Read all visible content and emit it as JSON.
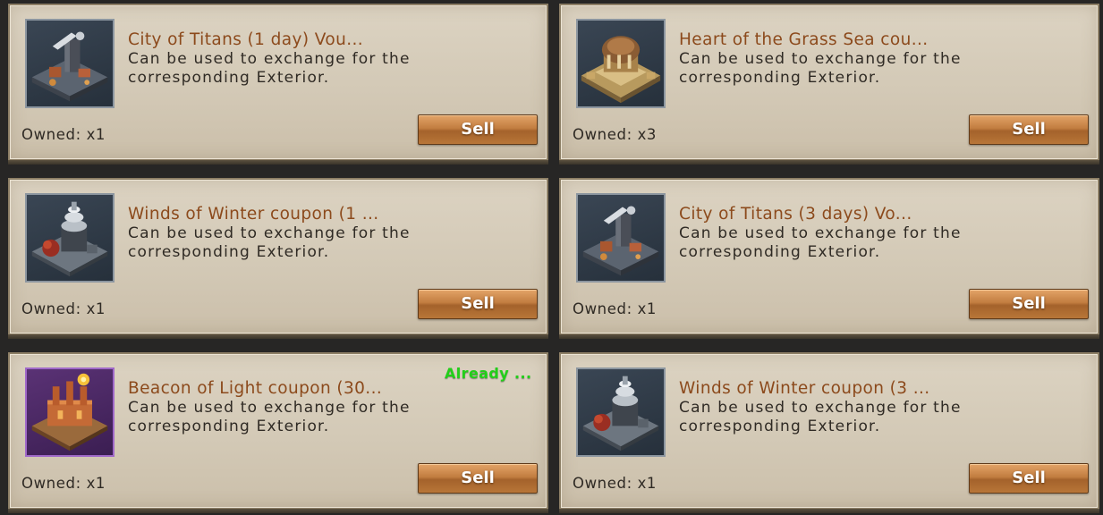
{
  "coupons": [
    {
      "title": "City of Titans (1 day) Vou...",
      "description": "Can be used to exchange for the corresponding Exterior.",
      "owned": "Owned: x1",
      "sell_label": "Sell",
      "icon": "city-of-titans-exterior-icon",
      "frame_color": "#8c96a0"
    },
    {
      "title": "Heart of the Grass Sea cou...",
      "description": "Can be used to exchange for the corresponding Exterior.",
      "owned": "Owned: x3",
      "sell_label": "Sell",
      "icon": "heart-of-the-grass-sea-exterior-icon",
      "frame_color": "#8c96a0"
    },
    {
      "title": "Winds of Winter coupon (1 ...",
      "description": "Can be used to exchange for the corresponding Exterior.",
      "owned": "Owned: x1",
      "sell_label": "Sell",
      "icon": "winds-of-winter-exterior-icon",
      "frame_color": "#8c96a0"
    },
    {
      "title": "City of Titans (3 days) Vo...",
      "description": "Can be used to exchange for the corresponding Exterior.",
      "owned": "Owned: x1",
      "sell_label": "Sell",
      "icon": "city-of-titans-exterior-icon",
      "frame_color": "#8c96a0"
    },
    {
      "title": "Beacon of Light coupon (30...",
      "description": "Can be used to exchange for the corresponding Exterior.",
      "owned": "Owned: x1",
      "sell_label": "Sell",
      "status": "Already ...",
      "status_color": "#22cf1a",
      "icon": "beacon-of-light-exterior-icon",
      "frame_color": "#a069c9"
    },
    {
      "title": "Winds of Winter coupon (3 ...",
      "description": "Can be used to exchange for the corresponding Exterior.",
      "owned": "Owned: x1",
      "sell_label": "Sell",
      "icon": "winds-of-winter-exterior-icon",
      "frame_color": "#8c96a0"
    }
  ],
  "colors": {
    "title": "#8c4a1c",
    "text": "#2f2a24",
    "panel": "#d6cdbb",
    "button": "#c27d40",
    "background": "#272625"
  }
}
